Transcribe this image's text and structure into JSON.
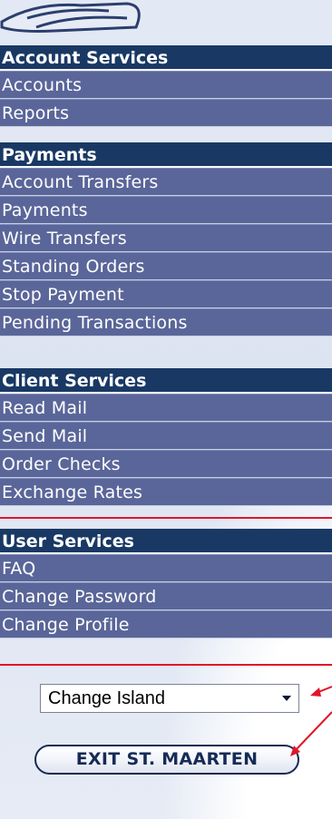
{
  "sections": [
    {
      "header": "Account Services",
      "items": [
        "Accounts",
        "Reports"
      ]
    },
    {
      "header": "Payments",
      "items": [
        "Account Transfers",
        "Payments",
        "Wire Transfers",
        "Standing Orders",
        "Stop Payment",
        "Pending Transactions"
      ]
    },
    {
      "header": "Client Services",
      "items": [
        "Read Mail",
        "Send Mail",
        "Order Checks",
        "Exchange Rates"
      ]
    },
    {
      "header": "User Services",
      "items": [
        "FAQ",
        "Change Password",
        "Change Profile"
      ]
    }
  ],
  "island_select": {
    "value": "Change Island"
  },
  "exit_button": {
    "label": "EXIT ST. MAARTEN"
  },
  "colors": {
    "header_bg": "#193964",
    "item_bg": "#5a6699",
    "annotation_red": "#e0162a"
  },
  "icons": [
    "logo-swoosh-icon",
    "dropdown-arrow-icon"
  ]
}
